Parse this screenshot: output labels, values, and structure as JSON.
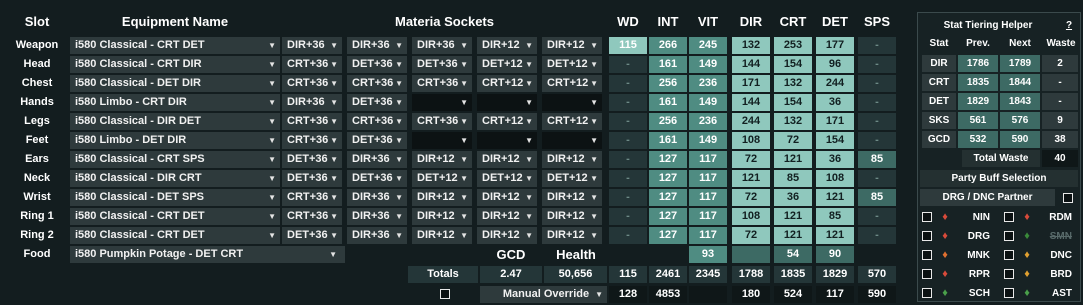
{
  "headers": {
    "slot": "Slot",
    "equipment": "Equipment Name",
    "materia": "Materia Sockets",
    "wd": "WD",
    "int": "INT",
    "vit": "VIT",
    "dir": "DIR",
    "crt": "CRT",
    "det": "DET",
    "sps": "SPS"
  },
  "rows": [
    {
      "slot": "Weapon",
      "equip": "i580 Classical - CRT DET",
      "materia": [
        "DIR+36",
        "DIR+36",
        "DIR+36",
        "DIR+12",
        "DIR+12"
      ],
      "wd": "115",
      "int": "266",
      "vit": "245",
      "dir": "132",
      "crt": "253",
      "det": "177",
      "sps": "-"
    },
    {
      "slot": "Head",
      "equip": "i580 Classical - CRT DIR",
      "materia": [
        "CRT+36",
        "DET+36",
        "DET+36",
        "DET+12",
        "DET+12"
      ],
      "wd": "-",
      "int": "161",
      "vit": "149",
      "dir": "144",
      "crt": "154",
      "det": "96",
      "sps": "-"
    },
    {
      "slot": "Chest",
      "equip": "i580 Classical - DET DIR",
      "materia": [
        "CRT+36",
        "CRT+36",
        "CRT+36",
        "CRT+12",
        "CRT+12"
      ],
      "wd": "-",
      "int": "256",
      "vit": "236",
      "dir": "171",
      "crt": "132",
      "det": "244",
      "sps": "-"
    },
    {
      "slot": "Hands",
      "equip": "i580 Limbo - CRT DIR",
      "materia": [
        "DIR+36",
        "DET+36",
        "",
        "",
        ""
      ],
      "wd": "-",
      "int": "161",
      "vit": "149",
      "dir": "144",
      "crt": "154",
      "det": "36",
      "sps": "-"
    },
    {
      "slot": "Legs",
      "equip": "i580 Classical - DIR DET",
      "materia": [
        "CRT+36",
        "CRT+36",
        "CRT+36",
        "CRT+12",
        "CRT+12"
      ],
      "wd": "-",
      "int": "256",
      "vit": "236",
      "dir": "244",
      "crt": "132",
      "det": "171",
      "sps": "-"
    },
    {
      "slot": "Feet",
      "equip": "i580 Limbo - DET DIR",
      "materia": [
        "CRT+36",
        "DET+36",
        "",
        "",
        ""
      ],
      "wd": "-",
      "int": "161",
      "vit": "149",
      "dir": "108",
      "crt": "72",
      "det": "154",
      "sps": "-"
    },
    {
      "slot": "Ears",
      "equip": "i580 Classical - CRT SPS",
      "materia": [
        "DET+36",
        "DIR+36",
        "DIR+12",
        "DIR+12",
        "DIR+12"
      ],
      "wd": "-",
      "int": "127",
      "vit": "117",
      "dir": "72",
      "crt": "121",
      "det": "36",
      "sps": "85"
    },
    {
      "slot": "Neck",
      "equip": "i580 Classical - DIR CRT",
      "materia": [
        "DET+36",
        "DET+36",
        "DET+12",
        "DET+12",
        "DET+12"
      ],
      "wd": "-",
      "int": "127",
      "vit": "117",
      "dir": "121",
      "crt": "85",
      "det": "108",
      "sps": "-"
    },
    {
      "slot": "Wrist",
      "equip": "i580 Classical - DET SPS",
      "materia": [
        "CRT+36",
        "DIR+36",
        "DIR+12",
        "DIR+12",
        "DIR+12"
      ],
      "wd": "-",
      "int": "127",
      "vit": "117",
      "dir": "72",
      "crt": "36",
      "det": "121",
      "sps": "85"
    },
    {
      "slot": "Ring 1",
      "equip": "i580 Classical - CRT DET",
      "materia": [
        "CRT+36",
        "DIR+36",
        "DIR+12",
        "DIR+12",
        "DIR+12"
      ],
      "wd": "-",
      "int": "127",
      "vit": "117",
      "dir": "108",
      "crt": "121",
      "det": "85",
      "sps": "-"
    },
    {
      "slot": "Ring 2",
      "equip": "i580 Classical - CRT DET",
      "materia": [
        "DET+36",
        "DIR+36",
        "DIR+12",
        "DIR+12",
        "DIR+12"
      ],
      "wd": "-",
      "int": "127",
      "vit": "117",
      "dir": "72",
      "crt": "121",
      "det": "121",
      "sps": "-"
    }
  ],
  "food": {
    "slot": "Food",
    "equip": "i580 Pumpkin Potage - DET CRT",
    "gcd_label": "GCD",
    "health_label": "Health",
    "vit": "93",
    "crt": "54",
    "det": "90"
  },
  "totals": {
    "label": "Totals",
    "gcd": "2.47",
    "health": "50,656",
    "wd": "115",
    "int": "2461",
    "vit": "2345",
    "dir": "1788",
    "crt": "1835",
    "det": "1829",
    "sps": "570"
  },
  "override": {
    "label": "Manual Override",
    "wd": "128",
    "int": "4853",
    "dir": "180",
    "crt": "524",
    "det": "117",
    "sps": "590"
  },
  "tiering": {
    "title": "Stat Tiering Helper",
    "help": "?",
    "cols": [
      "Stat",
      "Prev.",
      "Next",
      "Waste"
    ],
    "rows": [
      {
        "stat": "DIR",
        "prev": "1786",
        "next": "1789",
        "waste": "2"
      },
      {
        "stat": "CRT",
        "prev": "1835",
        "next": "1844",
        "waste": "-"
      },
      {
        "stat": "DET",
        "prev": "1829",
        "next": "1843",
        "waste": "-"
      },
      {
        "stat": "SKS",
        "prev": "561",
        "next": "576",
        "waste": "9"
      },
      {
        "stat": "GCD",
        "prev": "532",
        "next": "590",
        "waste": "38"
      }
    ],
    "total_label": "Total Waste",
    "total": "40"
  },
  "party": {
    "title": "Party Buff Selection",
    "partner": "DRG / DNC Partner",
    "jobs": [
      {
        "name": "NIN",
        "icon": "ninja-icon",
        "color": "#d84a3a"
      },
      {
        "name": "RDM",
        "icon": "redmage-icon",
        "color": "#d84a3a"
      },
      {
        "name": "DRG",
        "icon": "dragoon-icon",
        "color": "#d84a3a"
      },
      {
        "name": "SMN",
        "icon": "summoner-icon",
        "color": "#3a8a3a",
        "disabled": true
      },
      {
        "name": "MNK",
        "icon": "monk-icon",
        "color": "#e07030"
      },
      {
        "name": "DNC",
        "icon": "dancer-icon",
        "color": "#e0a030"
      },
      {
        "name": "RPR",
        "icon": "reaper-icon",
        "color": "#d84a3a"
      },
      {
        "name": "BRD",
        "icon": "bard-icon",
        "color": "#e0a030"
      },
      {
        "name": "SCH",
        "icon": "scholar-icon",
        "color": "#4aa04a"
      },
      {
        "name": "AST",
        "icon": "astrologian-icon",
        "color": "#4aa04a"
      }
    ]
  },
  "colors": {
    "bg": "#131d1f",
    "cell": "#2e3a3c",
    "stat_light": "#8fc8bd",
    "stat_mid": "#4f8c82",
    "stat_dark": "#3d6a64"
  }
}
